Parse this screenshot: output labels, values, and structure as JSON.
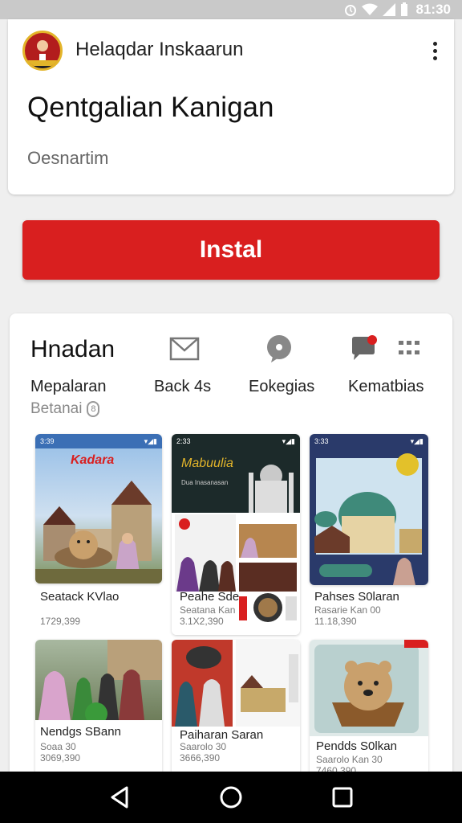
{
  "status_bar": {
    "time": "81:30"
  },
  "app": {
    "developer": "Helaqdar Inskaarun",
    "title": "Qentgalian Kanigan",
    "description": "Oesnartim",
    "install_label": "Instal"
  },
  "section": {
    "heading": "Hnadan",
    "categories": [
      "Mepalaran",
      "Back 4s",
      "Eokegias",
      "Kematbias"
    ],
    "rating_label": "Betanai",
    "rating_badge": "8"
  },
  "screenshots": [
    {
      "caption": "Seatack KVlao",
      "count": "1729,399",
      "banner": "Kadara"
    },
    {
      "caption": "Peahe Sde",
      "count": "3.1X2,390",
      "sub": "Seatana Kan",
      "banner": "Mabuulia",
      "banner_sub": "Dua Inasanasan"
    },
    {
      "caption": "Pahses S0laran",
      "count": "11.18,390",
      "sub": "Rasarie Kan 00"
    },
    {
      "caption": "Nendgs SBann",
      "count": "3069,390",
      "sub": "Soaa 30"
    },
    {
      "caption": "Paiharan Saran",
      "count": "3666,390",
      "sub": "Saarolo 30"
    },
    {
      "caption": "Pendds S0lkan",
      "count": "7460,390",
      "sub": "Saarolo Kan 30"
    }
  ],
  "colors": {
    "accent": "#d91f1f",
    "status_bar": "#c9c9c9",
    "nav_bar": "#000000"
  },
  "icons": [
    "mail-icon",
    "chat-bubble-icon",
    "notification-chat-icon",
    "grid-icon",
    "back-icon",
    "home-icon",
    "recents-icon"
  ]
}
